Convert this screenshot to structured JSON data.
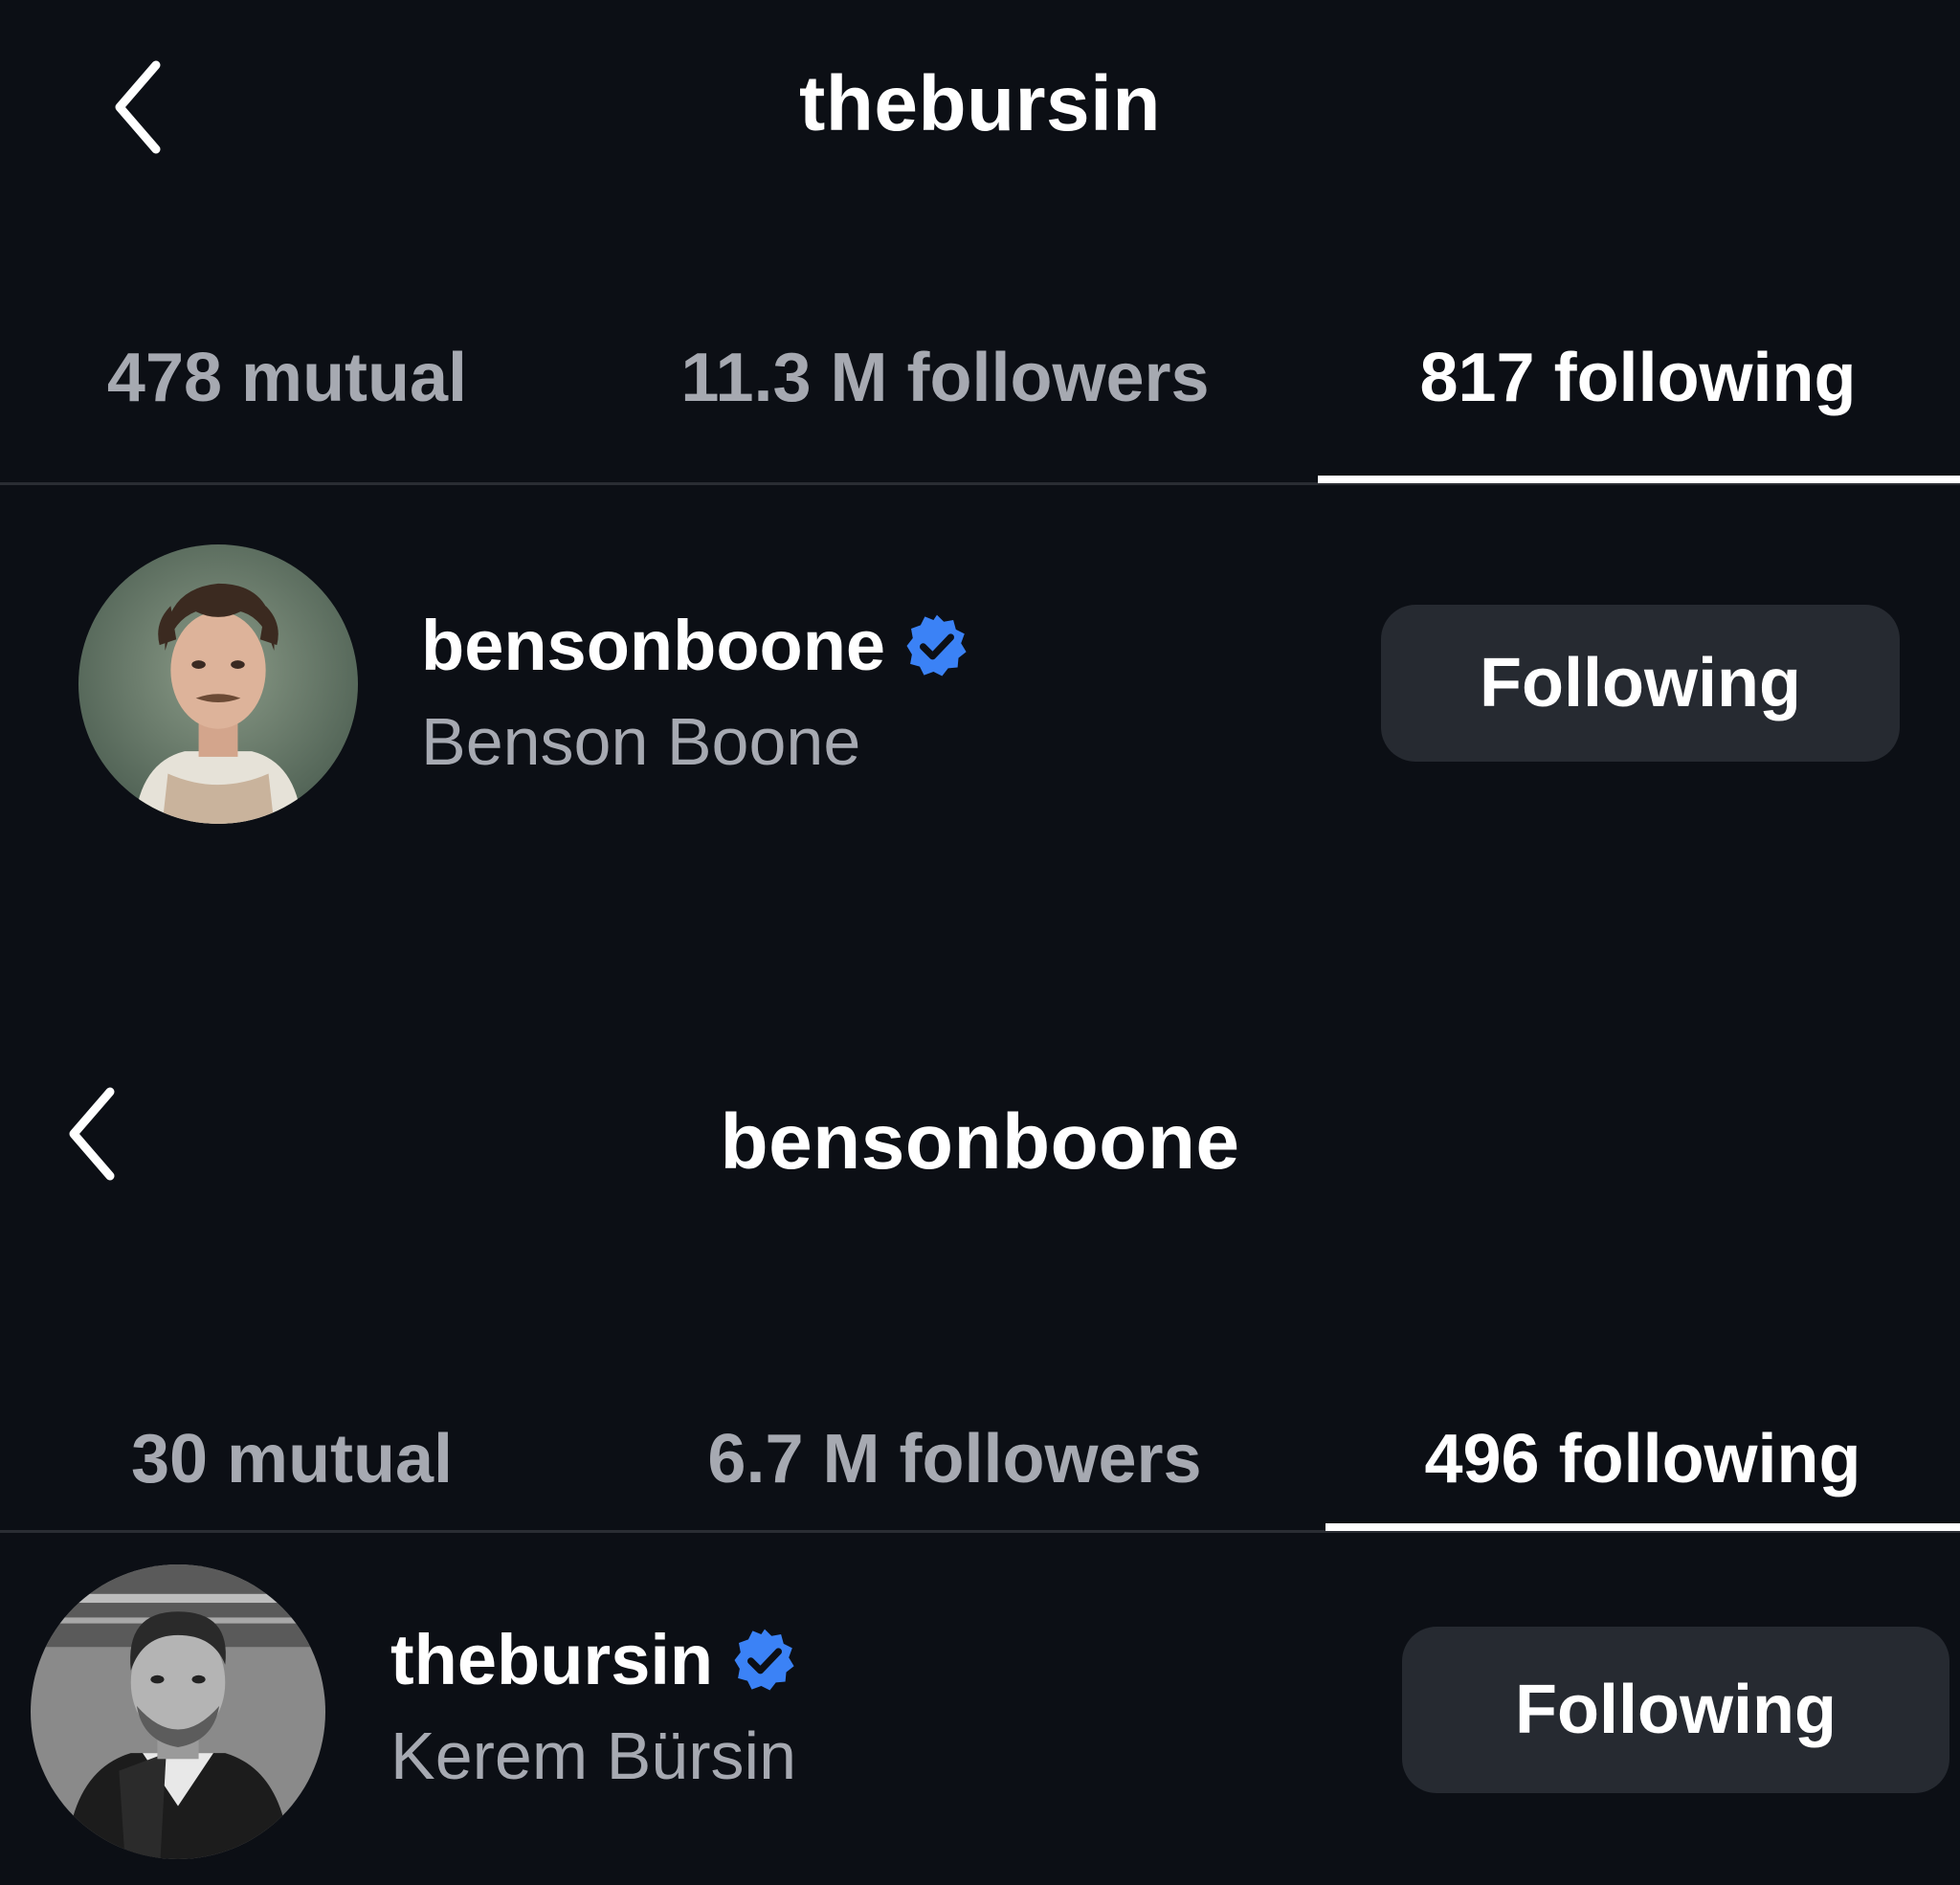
{
  "screens": [
    {
      "title": "thebursin",
      "tabs": [
        {
          "label": "478 mutual",
          "active": false
        },
        {
          "label": "11.3 M followers",
          "active": false
        },
        {
          "label": "817 following",
          "active": true
        }
      ],
      "user": {
        "username": "bensonboone",
        "full_name": "Benson Boone",
        "verified": true,
        "avatar_icon": "profile-photo-icon",
        "button_label": "Following"
      }
    },
    {
      "title": "bensonboone",
      "tabs": [
        {
          "label": "30 mutual",
          "active": false
        },
        {
          "label": "6.7 M followers",
          "active": false
        },
        {
          "label": "496 following",
          "active": true
        }
      ],
      "user": {
        "username": "thebursin",
        "full_name": "Kerem Bürsin",
        "verified": true,
        "avatar_icon": "profile-photo-icon",
        "button_label": "Following"
      }
    }
  ],
  "colors": {
    "background": "#0c0f15",
    "text_primary": "#ffffff",
    "text_secondary": "#a6a9b1",
    "button_bg": "#262a31",
    "verified_blue": "#3b82f6",
    "divider": "#2a2d33"
  },
  "icons": {
    "back": "chevron-left-icon",
    "verified": "verified-badge-icon"
  }
}
